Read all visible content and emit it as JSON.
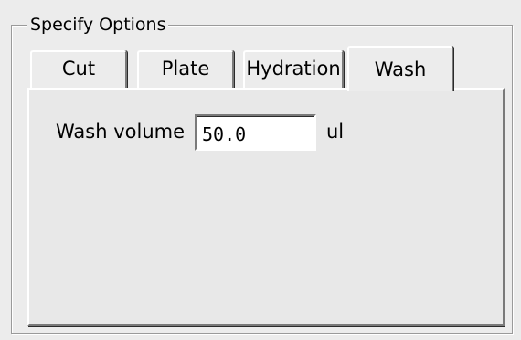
{
  "group": {
    "title": "Specify Options"
  },
  "tabs": [
    {
      "label": "Cut",
      "active": false
    },
    {
      "label": "Plate",
      "active": false
    },
    {
      "label": "Hydration",
      "active": false
    },
    {
      "label": "Wash",
      "active": true
    }
  ],
  "wash_tab": {
    "volume_label": "Wash volume",
    "volume_value": "50.0",
    "volume_unit": "ul"
  }
}
